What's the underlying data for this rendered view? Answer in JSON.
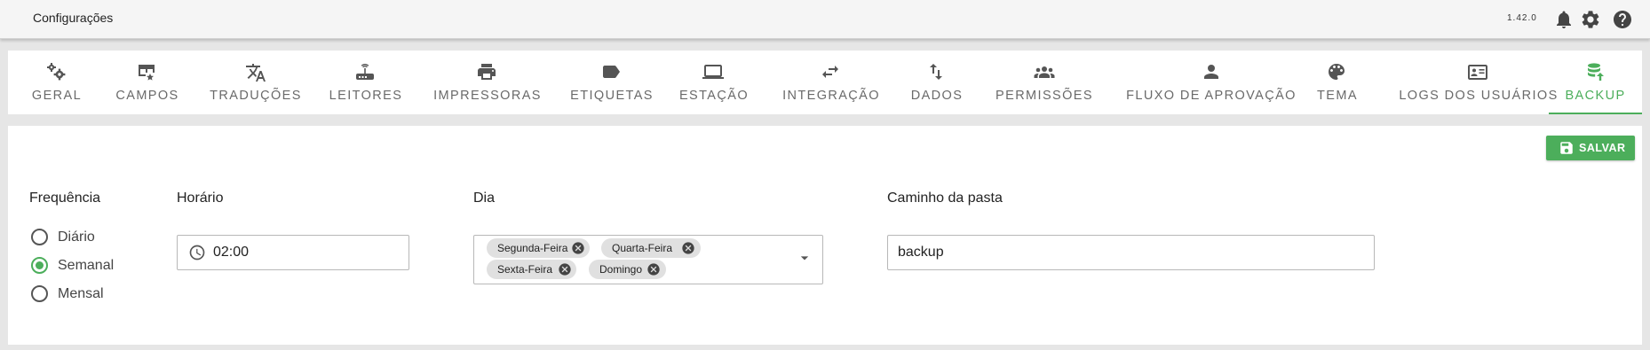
{
  "app": {
    "title": "Configurações",
    "version": "1.42.0"
  },
  "topbar_icons": [
    "bell-icon",
    "gear-icon",
    "help-icon"
  ],
  "tabs": [
    {
      "label": "GERAL",
      "icon": "gears-icon"
    },
    {
      "label": "CAMPOS",
      "icon": "table-edit-icon"
    },
    {
      "label": "TRADUÇÕES",
      "icon": "translate-icon"
    },
    {
      "label": "LEITORES",
      "icon": "router-icon"
    },
    {
      "label": "IMPRESSORAS",
      "icon": "printer-icon"
    },
    {
      "label": "ETIQUETAS",
      "icon": "label-icon"
    },
    {
      "label": "ESTAÇÃO",
      "icon": "laptop-icon"
    },
    {
      "label": "INTEGRAÇÃO",
      "icon": "swap-arrows-icon"
    },
    {
      "label": "DADOS",
      "icon": "import-export-icon"
    },
    {
      "label": "PERMISSÕES",
      "icon": "people-icon"
    },
    {
      "label": "FLUXO DE APROVAÇÃO",
      "icon": "person-icon"
    },
    {
      "label": "TEMA",
      "icon": "palette-icon"
    },
    {
      "label": "LOGS DOS USUÁRIOS",
      "icon": "id-card-icon"
    },
    {
      "label": "BACKUP",
      "icon": "database-upload-icon",
      "active": true
    }
  ],
  "save_button": {
    "label": "SALVAR"
  },
  "frequency": {
    "label": "Frequência",
    "options": [
      {
        "label": "Diário",
        "checked": false
      },
      {
        "label": "Semanal",
        "checked": true
      },
      {
        "label": "Mensal",
        "checked": false
      }
    ]
  },
  "schedule": {
    "label": "Horário",
    "value": "02:00"
  },
  "days": {
    "label": "Dia",
    "selected": [
      "Segunda-Feira",
      "Quarta-Feira",
      "Sexta-Feira",
      "Domingo"
    ]
  },
  "folder_path": {
    "label": "Caminho da pasta",
    "value": "backup"
  },
  "colors": {
    "accent": "#4cae5b",
    "topbar": "#f5f5f5",
    "background": "#e6e6e6"
  }
}
